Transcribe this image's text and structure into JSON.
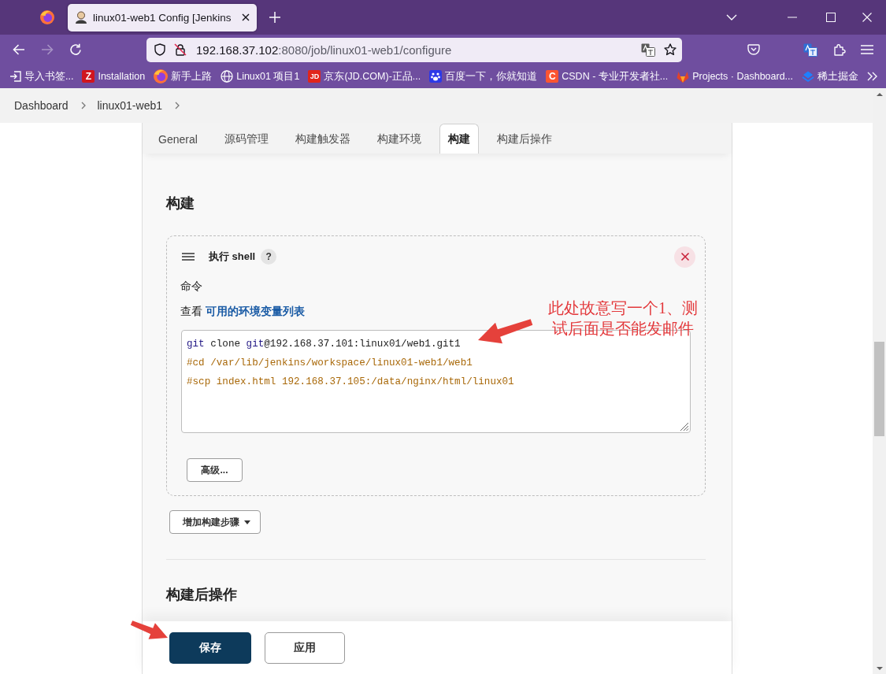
{
  "browser": {
    "tabs": [
      {
        "title": "linux01-web1 Config [Jenkins",
        "selected": true
      }
    ],
    "nav_buttons": [
      {
        "kind": "back",
        "disabled": false
      },
      {
        "kind": "forward",
        "disabled": true
      },
      {
        "kind": "reload",
        "disabled": false
      }
    ],
    "address": {
      "host": "192.168.37.102",
      "path": ":8080/job/linux01-web1/configure"
    },
    "bookmarks": [
      {
        "label": "导入书签..."
      },
      {
        "label": "Installation",
        "badge": "Z",
        "color": "#d0161e"
      },
      {
        "label": "新手上路"
      },
      {
        "label": "Linux01 项目1"
      },
      {
        "label": "京东(JD.COM)-正品...",
        "badge": "JD",
        "color": "#e1251b"
      },
      {
        "label": "百度一下，你就知道"
      },
      {
        "label": "CSDN - 专业开发者社...",
        "badge": "C",
        "color": "#fc5531"
      },
      {
        "label": "Projects · Dashboard..."
      },
      {
        "label": "稀土掘金"
      }
    ]
  },
  "breadcrumbs": [
    {
      "label": "Dashboard"
    },
    {
      "label": "linux01-web1"
    }
  ],
  "config_tabs": [
    {
      "label": "General",
      "selected": false
    },
    {
      "label": "源码管理",
      "selected": false
    },
    {
      "label": "构建触发器",
      "selected": false
    },
    {
      "label": "构建环境",
      "selected": false
    },
    {
      "label": "构建",
      "selected": true
    },
    {
      "label": "构建后操作",
      "selected": false
    }
  ],
  "build_section": {
    "heading": "构建",
    "steps": [
      {
        "title": "执行 shell",
        "help": "?",
        "field_label": "命令",
        "env_hint": {
          "prefix": "查看",
          "link": "可用的环境变量列表"
        },
        "command_lines": [
          {
            "tokens": [
              {
                "kind": "keyword",
                "text": "git"
              },
              {
                "kind": "plain",
                "text": " clone "
              },
              {
                "kind": "keyword",
                "text": "git"
              },
              {
                "kind": "plain",
                "text": "@192.168.37.101:linux01/web1.git1"
              }
            ]
          },
          {
            "tokens": [
              {
                "kind": "comment",
                "text": "#cd /var/lib/jenkins/workspace/linux01-web1/web1"
              }
            ]
          },
          {
            "tokens": [
              {
                "kind": "comment",
                "text": "#scp index.html 192.168.37.105:/data/nginx/html/linux01"
              }
            ]
          }
        ],
        "advanced_button": "高级..."
      }
    ],
    "add_step_button": "增加构建步骤"
  },
  "post_build_section": {
    "heading": "构建后操作"
  },
  "actions": [
    {
      "label": "保存",
      "kind": "primary"
    },
    {
      "label": "应用",
      "kind": "secondary"
    }
  ],
  "annotation": {
    "text": "此处故意写一个1、测试后面是否能发邮件"
  }
}
